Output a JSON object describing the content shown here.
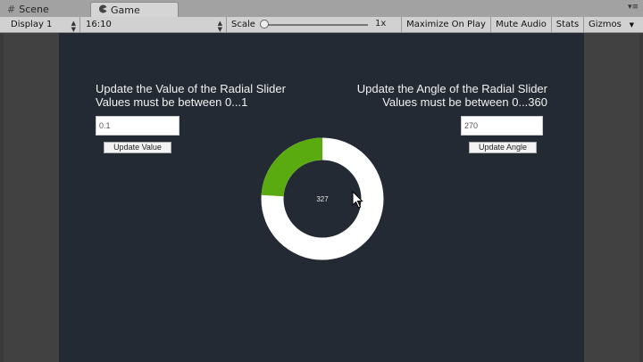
{
  "tabs": [
    {
      "label": "Scene",
      "icon": "grid-icon"
    },
    {
      "label": "Game",
      "icon": "pacman-icon"
    }
  ],
  "toolbar": {
    "display": "Display 1",
    "aspect": "16:10",
    "scale_label": "Scale",
    "scale_value": "1x",
    "maximize": "Maximize On Play",
    "mute": "Mute Audio",
    "stats": "Stats",
    "gizmos": "Gizmos"
  },
  "game": {
    "left": {
      "line1": "Update the Value of the Radial Slider",
      "line2": "Values must be between 0...1",
      "input_value": "0.1",
      "button": "Update Value"
    },
    "right": {
      "line1": "Update the Angle of the Radial Slider",
      "line2": "Values must be between 0...360",
      "input_value": "270",
      "button": "Update Angle"
    },
    "radial": {
      "center_text": "327",
      "fill_fraction": 0.24,
      "fill_color": "#5aab0f",
      "track_color": "#ffffff"
    }
  },
  "colors": {
    "canvas_bg": "#242a33",
    "editor_bg": "#414141"
  }
}
